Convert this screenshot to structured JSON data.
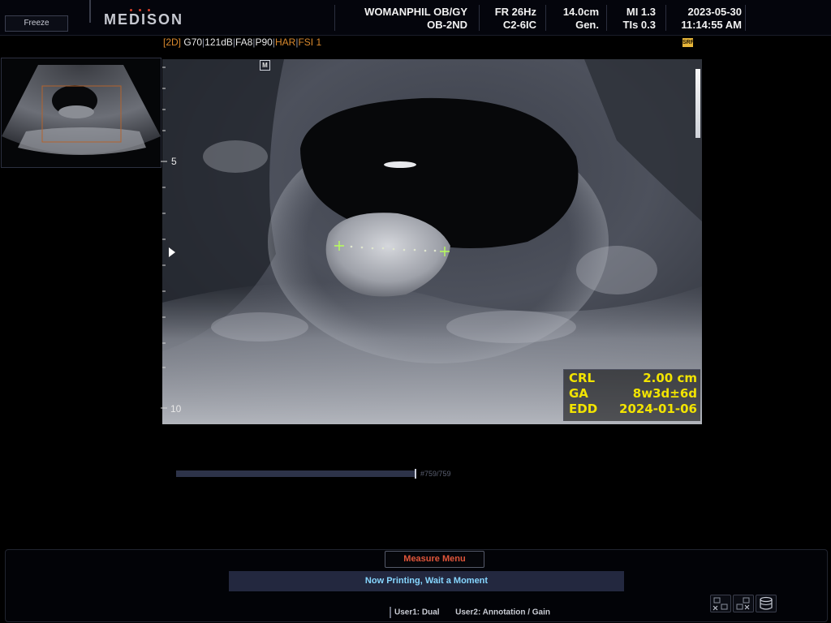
{
  "header": {
    "freeze_label": "Freeze",
    "brand": "MEDISON",
    "institution": "WOMANPHIL OB/GY",
    "preset": "OB-2ND",
    "frame_rate": "FR 26Hz",
    "probe": "C2-6IC",
    "depth": "14.0cm",
    "mode_gen": "Gen.",
    "mi": "MI 1.3",
    "tis": "TIs 0.3",
    "date": "2023-05-30",
    "time": "11:14:55 AM"
  },
  "imaging": {
    "mode": "[2D]",
    "gain": "G70",
    "dynamic_range": "121dB",
    "frame_avg": "FA8",
    "power": "P90",
    "harmonic": "HAR",
    "fsi": "FSI 1",
    "srf_badge": "SRF",
    "marker_label": "M",
    "depth_labels": [
      "5",
      "10"
    ]
  },
  "measurement": {
    "rows": [
      {
        "label": "CRL",
        "value": "2.00 cm"
      },
      {
        "label": "GA",
        "value": "8w3d±6d"
      },
      {
        "label": "EDD",
        "value": "2024-01-06"
      }
    ]
  },
  "cine": {
    "label": "#759/759"
  },
  "bottom": {
    "measure_menu_label": "Measure Menu",
    "status_message": "Now Printing, Wait a Moment",
    "user1": "User1: Dual",
    "user2": "User2: Annotation / Gain"
  },
  "colors": {
    "measurement_text": "#f2e400",
    "status_text": "#86d6ff",
    "menu_text": "#e0553a",
    "caliper": "#b8ff5a"
  }
}
